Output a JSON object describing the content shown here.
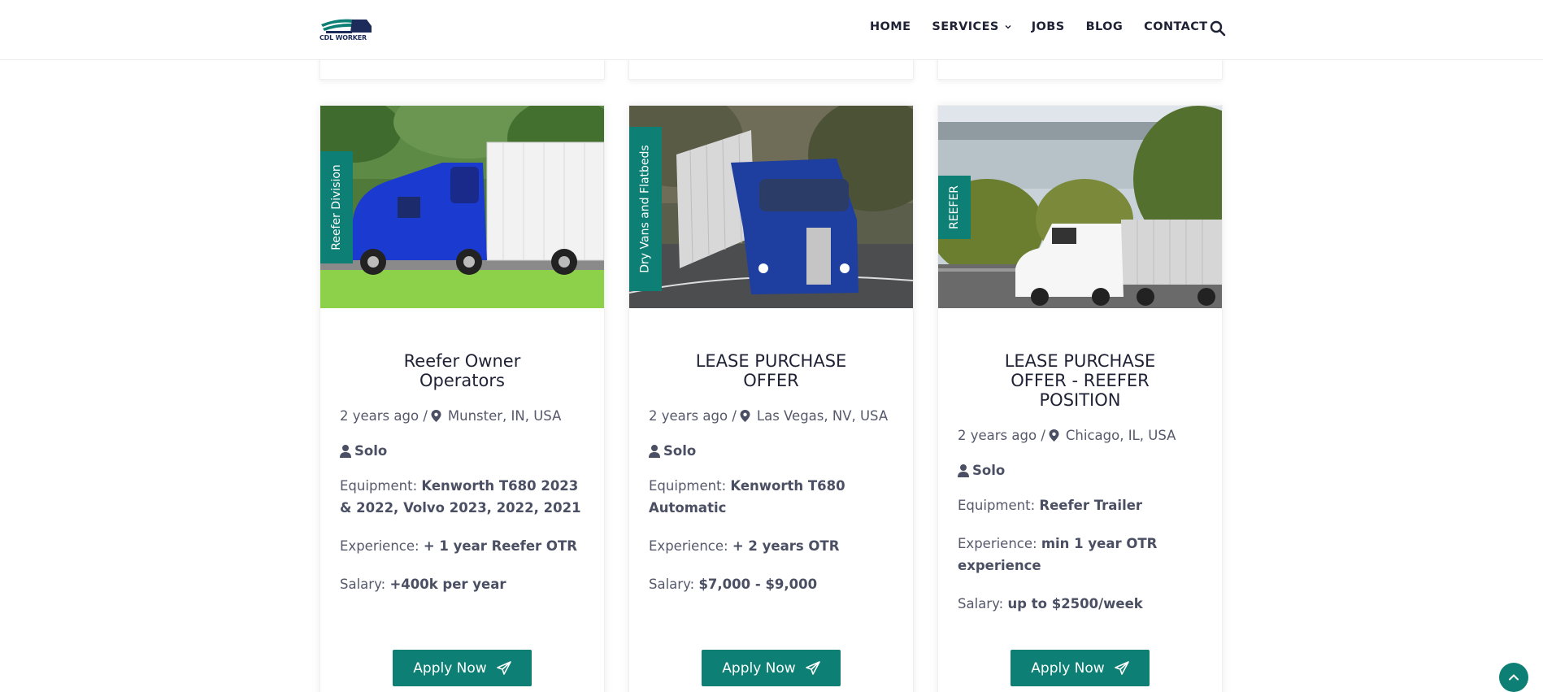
{
  "header": {
    "logo_text": "CDL WORKER",
    "nav": {
      "home": "HOME",
      "services": "SERVICES",
      "jobs": "JOBS",
      "blog": "BLOG",
      "contact": "CONTACT"
    },
    "icons": {
      "search": "search-icon",
      "services_dropdown": "chevron-down-icon"
    }
  },
  "jobs": [
    {
      "tag": "Reefer Division",
      "title": "Reefer Owner Operators",
      "posted": "2 years ago /",
      "location": "Munster, IN, USA",
      "driver_type": "Solo",
      "equipment_label": "Equipment:",
      "equipment": "Kenworth T680 2023 & 2022, Volvo 2023, 2022, 2021",
      "experience_label": "Experience:",
      "experience": "+ 1 year Reefer OTR",
      "salary_label": "Salary:",
      "salary": "+400k per year",
      "apply_label": "Apply Now"
    },
    {
      "tag": "Dry Vans and Flatbeds",
      "title": "LEASE PURCHASE OFFER",
      "posted": "2 years ago /",
      "location": "Las Vegas, NV, USA",
      "driver_type": "Solo",
      "equipment_label": "Equipment:",
      "equipment": "Kenworth T680 Automatic",
      "experience_label": "Experience:",
      "experience": "+ 2 years OTR",
      "salary_label": "Salary:",
      "salary": "$7,000 - $9,000",
      "apply_label": "Apply Now"
    },
    {
      "tag": "REEFER",
      "title": "LEASE PURCHASE OFFER - REEFER POSITION",
      "posted": "2 years ago /",
      "location": "Chicago, IL, USA",
      "driver_type": "Solo",
      "equipment_label": "Equipment:",
      "equipment": "Reefer Trailer",
      "experience_label": "Experience:",
      "experience": "min 1 year OTR experience",
      "salary_label": "Salary:",
      "salary": "up to $2500/week",
      "apply_label": "Apply Now"
    }
  ],
  "colors": {
    "accent": "#0d7f74",
    "heading": "#1f2235",
    "text": "#55596b"
  }
}
